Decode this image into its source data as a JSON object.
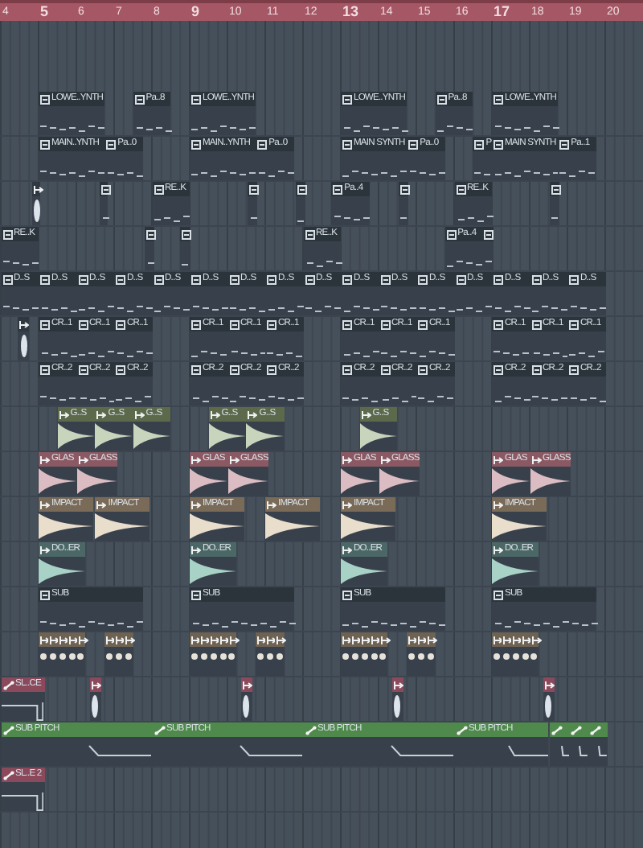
{
  "ruler": [
    "4",
    "5",
    "6",
    "7",
    "8",
    "9",
    "10",
    "11",
    "12",
    "13",
    "14",
    "15",
    "16",
    "17",
    "18",
    "19",
    "20"
  ],
  "tracks": [
    {
      "color": "#2f3841",
      "clips": [
        {
          "kind": "pattern",
          "label": "LOWE..YNTH"
        },
        {
          "kind": "pattern",
          "label": "Pa..8"
        },
        {
          "kind": "pattern",
          "label": "LOWE..YNTH"
        },
        {
          "kind": "pattern",
          "label": "LOWE..YNTH"
        },
        {
          "kind": "pattern",
          "label": "Pa..8"
        },
        {
          "kind": "pattern",
          "label": "LOWE..YNTH"
        }
      ]
    },
    {
      "color": "#2f3841",
      "clips": [
        {
          "kind": "pattern",
          "label": "MAIN..YNTH"
        },
        {
          "kind": "pattern",
          "label": "Pa..0"
        },
        {
          "kind": "pattern",
          "label": "MAIN..YNTH"
        },
        {
          "kind": "pattern",
          "label": "Pa..0"
        },
        {
          "kind": "pattern",
          "label": "MAIN SYNTH"
        },
        {
          "kind": "pattern",
          "label": "Pa..0"
        },
        {
          "kind": "pattern",
          "label": "P"
        },
        {
          "kind": "pattern",
          "label": "MAIN SYNTH"
        },
        {
          "kind": "pattern",
          "label": "Pa..1"
        }
      ]
    },
    {
      "color": "#2f3841",
      "clips": [
        {
          "kind": "audio"
        },
        {
          "kind": "pattern"
        },
        {
          "kind": "pattern",
          "label": "RE..K"
        },
        {
          "kind": "pattern"
        },
        {
          "kind": "pattern"
        },
        {
          "kind": "pattern",
          "label": "Pa..4"
        },
        {
          "kind": "pattern"
        },
        {
          "kind": "pattern",
          "label": "RE..K"
        },
        {
          "kind": "pattern"
        }
      ]
    },
    {
      "color": "#2f3841",
      "clips": [
        {
          "kind": "pattern",
          "label": "RE..K"
        },
        {
          "kind": "pattern"
        },
        {
          "kind": "pattern"
        },
        {
          "kind": "pattern",
          "label": "RE..K"
        },
        {
          "kind": "pattern",
          "label": "Pa..4"
        },
        {
          "kind": "pattern"
        }
      ]
    },
    {
      "color": "#2f3841",
      "clips": [
        {
          "kind": "pattern",
          "label": "D..S"
        },
        {
          "kind": "pattern",
          "label": "D..S"
        },
        {
          "kind": "pattern",
          "label": "D..S"
        },
        {
          "kind": "pattern",
          "label": "D..S"
        },
        {
          "kind": "pattern",
          "label": "D..S"
        },
        {
          "kind": "pattern",
          "label": "D..S"
        },
        {
          "kind": "pattern",
          "label": "D..S"
        },
        {
          "kind": "pattern",
          "label": "D..S"
        },
        {
          "kind": "pattern",
          "label": "D..S"
        },
        {
          "kind": "pattern",
          "label": "D..S"
        },
        {
          "kind": "pattern",
          "label": "D..S"
        },
        {
          "kind": "pattern",
          "label": "D..S"
        },
        {
          "kind": "pattern",
          "label": "D..S"
        },
        {
          "kind": "pattern",
          "label": "D..S"
        },
        {
          "kind": "pattern",
          "label": "D..S"
        },
        {
          "kind": "pattern",
          "label": "D..S"
        }
      ]
    },
    {
      "color": "#2f3841",
      "clips": [
        {
          "kind": "audio"
        },
        {
          "kind": "pattern",
          "label": "CR..1"
        },
        {
          "kind": "pattern",
          "label": "CR..1"
        },
        {
          "kind": "pattern",
          "label": "CR..1"
        },
        {
          "kind": "pattern",
          "label": "CR..1"
        },
        {
          "kind": "pattern",
          "label": "CR..1"
        },
        {
          "kind": "pattern",
          "label": "CR..1"
        },
        {
          "kind": "pattern",
          "label": "CR..1"
        },
        {
          "kind": "pattern",
          "label": "CR..1"
        },
        {
          "kind": "pattern",
          "label": "CR..1"
        },
        {
          "kind": "pattern",
          "label": "CR..1"
        },
        {
          "kind": "pattern",
          "label": "CR..1"
        },
        {
          "kind": "pattern",
          "label": "CR..1"
        }
      ]
    },
    {
      "color": "#2f3841",
      "clips": [
        {
          "kind": "pattern",
          "label": "CR..2"
        },
        {
          "kind": "pattern",
          "label": "CR..2"
        },
        {
          "kind": "pattern",
          "label": "CR..2"
        },
        {
          "kind": "pattern",
          "label": "CR..2"
        },
        {
          "kind": "pattern",
          "label": "CR..2"
        },
        {
          "kind": "pattern",
          "label": "CR..2"
        },
        {
          "kind": "pattern",
          "label": "CR..2"
        },
        {
          "kind": "pattern",
          "label": "CR..2"
        },
        {
          "kind": "pattern",
          "label": "CR..2"
        },
        {
          "kind": "pattern",
          "label": "CR..2"
        },
        {
          "kind": "pattern",
          "label": "CR..2"
        },
        {
          "kind": "pattern",
          "label": "CR..2"
        }
      ]
    },
    {
      "color": "#5c6a4b",
      "clips": [
        {
          "kind": "audio",
          "label": "G..S"
        },
        {
          "kind": "audio",
          "label": "G..S"
        },
        {
          "kind": "audio",
          "label": "G..S"
        },
        {
          "kind": "audio",
          "label": "G..S"
        },
        {
          "kind": "audio",
          "label": "G..S"
        },
        {
          "kind": "audio",
          "label": "G..S"
        }
      ]
    },
    {
      "color": "#8a5963",
      "clips": [
        {
          "kind": "audio",
          "label": "GLAS"
        },
        {
          "kind": "audio",
          "label": "GLASS"
        },
        {
          "kind": "audio",
          "label": "GLAS"
        },
        {
          "kind": "audio",
          "label": "GLASS"
        },
        {
          "kind": "audio",
          "label": "GLAS"
        },
        {
          "kind": "audio",
          "label": "GLASS"
        },
        {
          "kind": "audio",
          "label": "GLAS"
        },
        {
          "kind": "audio",
          "label": "GLASS"
        }
      ]
    },
    {
      "color": "#7a6a58",
      "clips": [
        {
          "kind": "audio",
          "label": "IMPACT"
        },
        {
          "kind": "audio",
          "label": "IMPACT"
        },
        {
          "kind": "audio",
          "label": "IMPACT"
        },
        {
          "kind": "audio",
          "label": "IMPACT"
        },
        {
          "kind": "audio",
          "label": "IMPACT"
        },
        {
          "kind": "audio",
          "label": "IMPACT"
        }
      ]
    },
    {
      "color": "#4c6866",
      "clips": [
        {
          "kind": "audio",
          "label": "DO..ER"
        },
        {
          "kind": "audio",
          "label": "DO..ER"
        },
        {
          "kind": "audio",
          "label": "DO..ER"
        },
        {
          "kind": "audio",
          "label": "DO..ER"
        }
      ]
    },
    {
      "color": "#2f3841",
      "clips": [
        {
          "kind": "pattern",
          "label": "SUB"
        },
        {
          "kind": "pattern",
          "label": "SUB"
        },
        {
          "kind": "pattern",
          "label": "SUB"
        },
        {
          "kind": "pattern",
          "label": "SUB"
        }
      ]
    },
    {
      "color": "#6e6252",
      "clips": [
        {
          "kind": "audio"
        },
        {
          "kind": "audio"
        },
        {
          "kind": "audio"
        },
        {
          "kind": "audio"
        },
        {
          "kind": "audio"
        },
        {
          "kind": "audio"
        },
        {
          "kind": "audio"
        },
        {
          "kind": "audio"
        },
        {
          "kind": "audio"
        },
        {
          "kind": "audio"
        },
        {
          "kind": "audio"
        },
        {
          "kind": "audio"
        },
        {
          "kind": "audio"
        },
        {
          "kind": "audio"
        },
        {
          "kind": "audio"
        },
        {
          "kind": "audio"
        },
        {
          "kind": "audio"
        },
        {
          "kind": "audio"
        },
        {
          "kind": "audio"
        },
        {
          "kind": "audio"
        },
        {
          "kind": "audio"
        },
        {
          "kind": "audio"
        },
        {
          "kind": "audio"
        },
        {
          "kind": "audio"
        },
        {
          "kind": "audio"
        },
        {
          "kind": "audio"
        },
        {
          "kind": "audio"
        },
        {
          "kind": "audio"
        },
        {
          "kind": "audio"
        }
      ]
    },
    {
      "color": "#8a4a5c",
      "clips": [
        {
          "kind": "automation",
          "label": "SL..CE"
        },
        {
          "kind": "audio"
        },
        {
          "kind": "audio"
        },
        {
          "kind": "audio"
        },
        {
          "kind": "audio"
        }
      ]
    },
    {
      "color": "#4f8a4c",
      "clips": [
        {
          "kind": "automation",
          "label": "SUB PITCH"
        },
        {
          "kind": "automation",
          "label": "SUB PITCH"
        },
        {
          "kind": "automation",
          "label": "SUB PITCH"
        },
        {
          "kind": "automation",
          "label": "SUB PITCH"
        },
        {
          "kind": "automation"
        },
        {
          "kind": "automation"
        },
        {
          "kind": "automation"
        }
      ]
    },
    {
      "color": "#8a4a5c",
      "clips": [
        {
          "kind": "automation",
          "label": "SL..E 2"
        }
      ]
    }
  ]
}
